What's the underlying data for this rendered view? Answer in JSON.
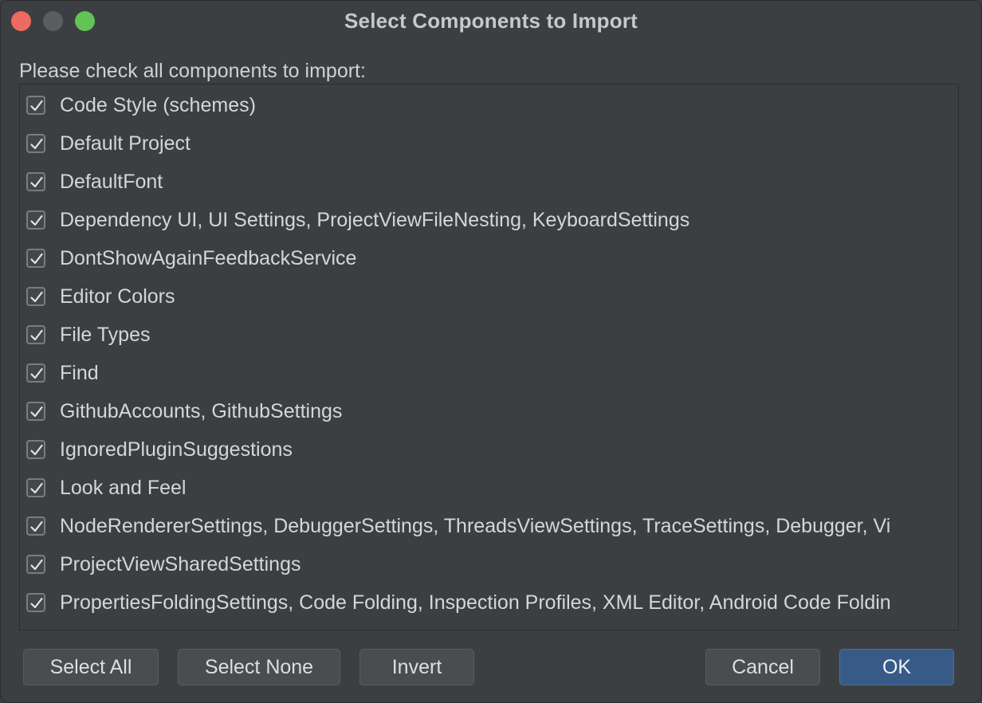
{
  "window": {
    "title": "Select Components to Import"
  },
  "prompt": "Please check all components to import:",
  "components": [
    {
      "label": "Code Style (schemes)",
      "checked": true
    },
    {
      "label": "Default Project",
      "checked": true
    },
    {
      "label": "DefaultFont",
      "checked": true
    },
    {
      "label": "Dependency UI, UI Settings, ProjectViewFileNesting, KeyboardSettings",
      "checked": true
    },
    {
      "label": "DontShowAgainFeedbackService",
      "checked": true
    },
    {
      "label": "Editor Colors",
      "checked": true
    },
    {
      "label": "File Types",
      "checked": true
    },
    {
      "label": "Find",
      "checked": true
    },
    {
      "label": "GithubAccounts, GithubSettings",
      "checked": true
    },
    {
      "label": "IgnoredPluginSuggestions",
      "checked": true
    },
    {
      "label": "Look and Feel",
      "checked": true
    },
    {
      "label": "NodeRendererSettings, DebuggerSettings, ThreadsViewSettings, TraceSettings, Debugger, Vi",
      "checked": true
    },
    {
      "label": "ProjectViewSharedSettings",
      "checked": true
    },
    {
      "label": "PropertiesFoldingSettings, Code Folding, Inspection Profiles, XML Editor, Android Code Foldin",
      "checked": true
    }
  ],
  "buttons": {
    "select_all": "Select All",
    "select_none": "Select None",
    "invert": "Invert",
    "cancel": "Cancel",
    "ok": "OK"
  },
  "colors": {
    "background": "#3c3f41",
    "primary_button": "#375a87",
    "traffic_close": "#ed6a5e",
    "traffic_minimize": "#5b5d5f",
    "traffic_zoom": "#61c454"
  }
}
